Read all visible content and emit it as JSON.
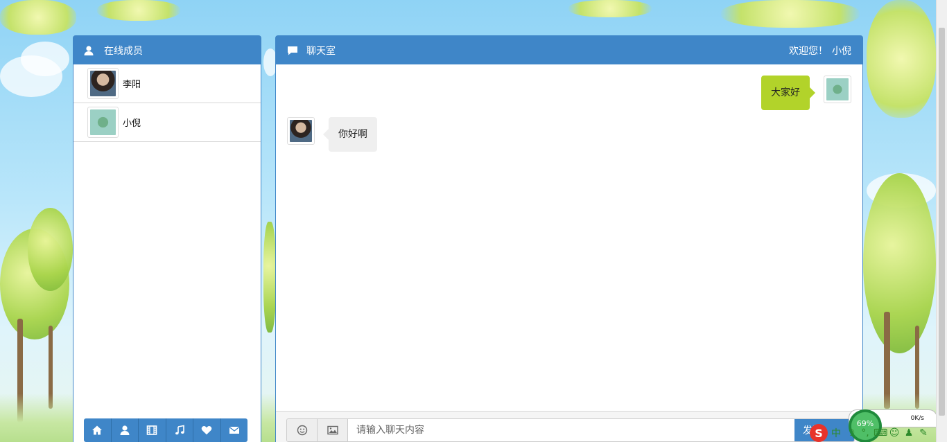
{
  "members_panel": {
    "title": "在线成员",
    "members": [
      {
        "name": "李阳",
        "avatar": "avatar-man"
      },
      {
        "name": "小倪",
        "avatar": "avatar-leaf"
      }
    ],
    "toolbar_icons": [
      "home-icon",
      "user-icon",
      "film-icon",
      "music-icon",
      "heart-icon",
      "envelope-icon"
    ]
  },
  "chat_panel": {
    "title": "聊天室",
    "welcome": "欢迎您！",
    "current_user": "小倪",
    "messages": [
      {
        "side": "right",
        "text": "大家好",
        "avatar": "avatar-leaf"
      },
      {
        "side": "left",
        "text": "你好啊",
        "avatar": "avatar-man"
      }
    ],
    "input": {
      "placeholder": "请输入聊天内容",
      "value": ""
    },
    "send_label": "发送"
  },
  "tray": {
    "ime_logo": "S",
    "ime_mode": "中",
    "net_percent": "69%",
    "net_speed": "0K/s"
  },
  "colors": {
    "primary": "#3f86c8",
    "bubble_self": "#b2d32a",
    "bubble_other": "#efefef"
  }
}
